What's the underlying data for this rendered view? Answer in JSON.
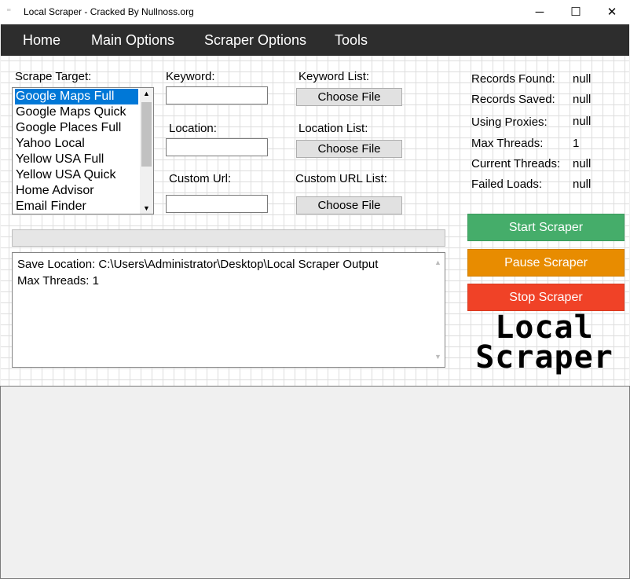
{
  "window": {
    "title": "Local Scraper - Cracked By Nullnoss.org",
    "icon_text": "Local Scraper",
    "minimize": "─",
    "maximize": "☐",
    "close": "✕"
  },
  "menu": [
    "Home",
    "Main Options",
    "Scraper Options",
    "Tools"
  ],
  "scrape_target": {
    "label": "Scrape Target:",
    "options": [
      "Google Maps Full",
      "Google Maps Quick",
      "Google Places Full",
      "Yahoo Local",
      "Yellow USA Full",
      "Yellow USA Quick",
      "Home Advisor",
      "Email Finder"
    ],
    "selected": "Google Maps Full"
  },
  "fields": {
    "keyword": {
      "label": "Keyword:",
      "value": ""
    },
    "location": {
      "label": "Location:",
      "value": ""
    },
    "custom_url": {
      "label": "Custom Url:",
      "value": ""
    }
  },
  "lists": {
    "keyword": {
      "label": "Keyword List:",
      "button": "Choose File"
    },
    "location": {
      "label": "Location List:",
      "button": "Choose File"
    },
    "custom_url": {
      "label": "Custom URL List:",
      "button": "Choose File"
    }
  },
  "stats": [
    {
      "label": "Records Found:",
      "value": "null"
    },
    {
      "label": "Records Saved:",
      "value": "null"
    },
    {
      "label": "Using Proxies:",
      "value": "null"
    },
    {
      "label": "Max Threads:",
      "value": "1"
    },
    {
      "label": "Current Threads:",
      "value": "null"
    },
    {
      "label": "Failed Loads:",
      "value": "null"
    }
  ],
  "buttons": {
    "start": "Start Scraper",
    "pause": "Pause Scraper",
    "stop": "Stop Scraper"
  },
  "colors": {
    "start": "#45ad6a",
    "pause": "#e88c00",
    "stop": "#f04227",
    "menubar": "#2d2d2d",
    "selection": "#0078d7"
  },
  "progress": 0,
  "log": [
    "Save Location: C:\\Users\\Administrator\\Desktop\\Local Scraper Output",
    "Max Threads: 1"
  ],
  "logo": {
    "line1": "Local",
    "line2": "Scraper"
  }
}
